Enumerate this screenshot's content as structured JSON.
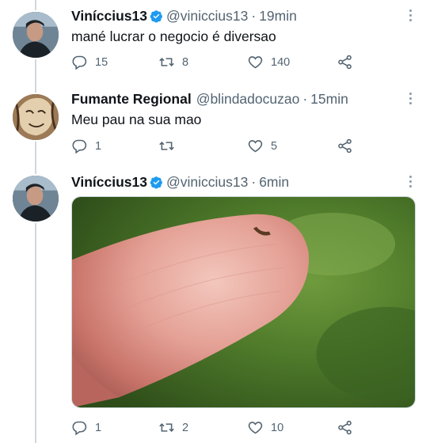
{
  "tweets": [
    {
      "name": "Viníccius13",
      "verified": true,
      "handle": "@viniccius13",
      "separator": "·",
      "time": "19min",
      "text": "mané lucrar o negocio é diversao",
      "replies": "15",
      "retweets": "8",
      "likes": "140",
      "avatar": "user-photo-avatar"
    },
    {
      "name": "Fumante Regional",
      "verified": false,
      "handle": "@blindadocuzao",
      "separator": "·",
      "time": "15min",
      "text": "Meu pau na sua mao",
      "replies": "1",
      "retweets": "",
      "likes": "5",
      "avatar": "cartoon-face-avatar"
    },
    {
      "name": "Viníccius13",
      "verified": true,
      "handle": "@viniccius13",
      "separator": "·",
      "time": "6min",
      "text": "",
      "replies": "1",
      "retweets": "2",
      "likes": "10",
      "avatar": "user-photo-avatar",
      "media": "photo of a fingertip with a tiny object on it, green blurred background"
    }
  ],
  "icons": {
    "reply": "reply-icon",
    "retweet": "retweet-icon",
    "like": "like-icon",
    "share": "share-icon",
    "more": "more-icon",
    "verified": "verified-badge-icon"
  },
  "colors": {
    "verified": "#1d9bf0",
    "secondary_text": "#536471",
    "thread_line": "#cfd9de"
  }
}
